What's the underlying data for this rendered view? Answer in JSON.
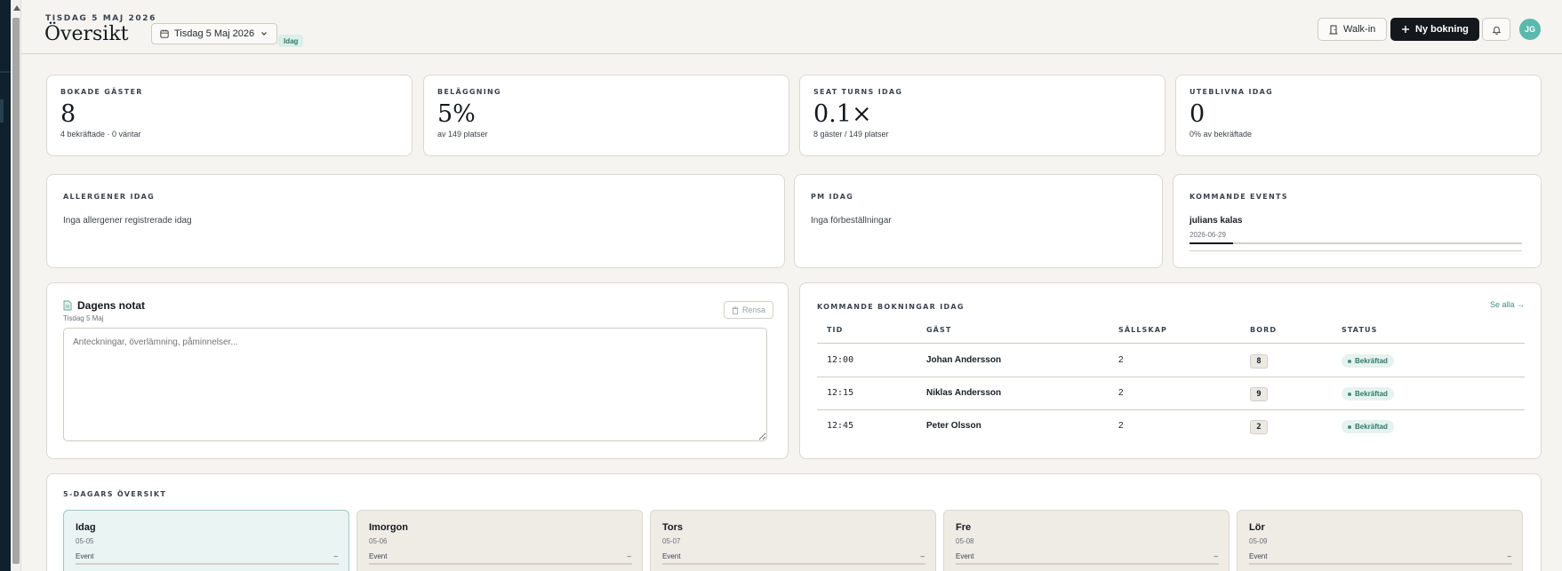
{
  "header": {
    "date_eyebrow": "TISDAG 5 MAJ 2026",
    "title": "Översikt",
    "date_picker_label": "Tisdag 5 Maj 2026",
    "today_badge": "Idag",
    "walkin_label": "Walk-in",
    "new_booking_label": "Ny bokning",
    "avatar_initials": "JG"
  },
  "kpis": [
    {
      "label": "BOKADE GÄSTER",
      "value": "8",
      "sub": "4 bekräftade · 0 väntar"
    },
    {
      "label": "BELÄGGNING",
      "value": "5%",
      "sub": "av 149 platser"
    },
    {
      "label": "SEAT TURNS IDAG",
      "value": "0.1×",
      "sub": "8 gäster / 149 platser"
    },
    {
      "label": "UTEBLIVNA IDAG",
      "value": "0",
      "sub": "0% av bekräftade"
    }
  ],
  "allergens": {
    "label": "ALLERGENER IDAG",
    "text": "Inga allergener registrerade idag"
  },
  "pm": {
    "label": "PM IDAG",
    "text": "Inga förbeställningar"
  },
  "events": {
    "label": "KOMMANDE EVENTS",
    "items": [
      {
        "name": "julians kalas",
        "date": "2026-06-29",
        "progress": 0.13
      }
    ]
  },
  "notes": {
    "title": "Dagens notat",
    "subtitle": "Tisdag 5 Maj",
    "clear_label": "Rensa",
    "placeholder": "Anteckningar, överlämning, påminnelser..."
  },
  "bookings": {
    "label": "KOMMANDE BOKNINGAR IDAG",
    "see_all": "Se alla →",
    "columns": [
      "TID",
      "GÄST",
      "SÄLLSKAP",
      "BORD",
      "STATUS"
    ],
    "rows": [
      {
        "time": "12:00",
        "guest": "Johan Andersson",
        "party": "2",
        "table": "8",
        "status": "Bekräftad"
      },
      {
        "time": "12:15",
        "guest": "Niklas Andersson",
        "party": "2",
        "table": "9",
        "status": "Bekräftad"
      },
      {
        "time": "12:45",
        "guest": "Peter Olsson",
        "party": "2",
        "table": "2",
        "status": "Bekräftad"
      }
    ]
  },
  "five_day": {
    "label": "5-DAGARS ÖVERSIKT",
    "days": [
      {
        "name": "Idag",
        "date": "05-05",
        "event_label": "Event",
        "event_value": "–"
      },
      {
        "name": "Imorgon",
        "date": "05-06",
        "event_label": "Event",
        "event_value": "–"
      },
      {
        "name": "Tors",
        "date": "05-07",
        "event_label": "Event",
        "event_value": "–"
      },
      {
        "name": "Fre",
        "date": "05-08",
        "event_label": "Event",
        "event_value": "–"
      },
      {
        "name": "Lör",
        "date": "05-09",
        "event_label": "Event",
        "event_value": "–"
      }
    ]
  },
  "colors": {
    "accent": "#3f8f84",
    "primary_button": "#14181d",
    "avatar": "#5bb8ad"
  }
}
